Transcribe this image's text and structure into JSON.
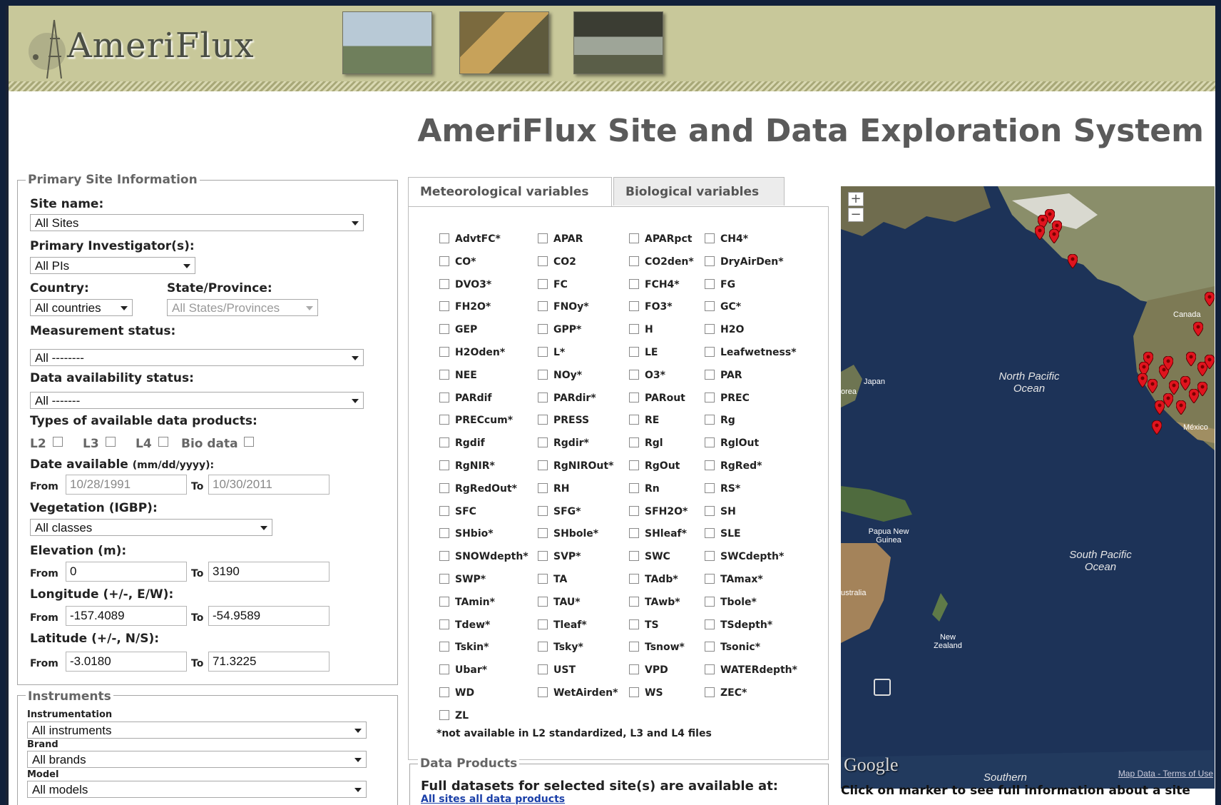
{
  "header": {
    "logo_text": "AmeriFlux",
    "page_title": "AmeriFlux Site and Data Exploration System"
  },
  "primary": {
    "legend": "Primary Site Information",
    "site_name_label": "Site name:",
    "site_name_value": "All Sites",
    "pi_label": "Primary Investigator(s):",
    "pi_value": "All PIs",
    "country_label": "Country:",
    "country_value": "All countries",
    "state_label": "State/Province:",
    "state_value": "All States/Provinces",
    "measurement_label": "Measurement status:",
    "measurement_value": "All --------",
    "availability_label": "Data availability status:",
    "availability_value": "All -------",
    "types_label": "Types of available data products:",
    "types": [
      "L2",
      "L3",
      "L4",
      "Bio data"
    ],
    "date_label": "Date available",
    "date_fmt": "(mm/dd/yyyy):",
    "from": "From",
    "to": "To",
    "date_from_placeholder": "10/28/1991",
    "date_to_placeholder": "10/30/2011",
    "veg_label": "Vegetation (IGBP):",
    "veg_value": "All classes",
    "elev_label": "Elevation (m):",
    "elev_from": "0",
    "elev_to": "3190",
    "lon_label": "Longitude (+/-, E/W):",
    "lon_from": "-157.4089",
    "lon_to": "-54.9589",
    "lat_label": "Latitude (+/-, N/S):",
    "lat_from": "-3.0180",
    "lat_to": "71.3225"
  },
  "instruments": {
    "legend": "Instruments",
    "instrumentation_label": "Instrumentation",
    "instrumentation_value": "All instruments",
    "brand_label": "Brand",
    "brand_value": "All brands",
    "model_label": "Model",
    "model_value": "All models"
  },
  "tabs": [
    "Meteorological variables",
    "Biological variables"
  ],
  "variables": [
    "AdvtFC*",
    "APAR",
    "APARpct",
    "CH4*",
    "CO*",
    "CO2",
    "CO2den*",
    "DryAirDen*",
    "DVO3*",
    "FC",
    "FCH4*",
    "FG",
    "FH2O*",
    "FNOy*",
    "FO3*",
    "GC*",
    "GEP",
    "GPP*",
    "H",
    "H2O",
    "H2Oden*",
    "L*",
    "LE",
    "Leafwetness*",
    "NEE",
    "NOy*",
    "O3*",
    "PAR",
    "PARdif",
    "PARdir*",
    "PARout",
    "PREC",
    "PRECcum*",
    "PRESS",
    "RE",
    "Rg",
    "Rgdif",
    "Rgdir*",
    "Rgl",
    "RglOut",
    "RgNIR*",
    "RgNIROut*",
    "RgOut",
    "RgRed*",
    "RgRedOut*",
    "RH",
    "Rn",
    "RS*",
    "SFC",
    "SFG*",
    "SFH2O*",
    "SH",
    "SHbio*",
    "SHbole*",
    "SHleaf*",
    "SLE",
    "SNOWdepth*",
    "SVP*",
    "SWC",
    "SWCdepth*",
    "SWP*",
    "TA",
    "TAdb*",
    "TAmax*",
    "TAmin*",
    "TAU*",
    "TAwb*",
    "Tbole*",
    "Tdew*",
    "Tleaf*",
    "TS",
    "TSdepth*",
    "Tskin*",
    "Tsky*",
    "Tsnow*",
    "Tsonic*",
    "Ubar*",
    "UST",
    "VPD",
    "WATERdepth*",
    "WD",
    "WetAirden*",
    "WS",
    "ZEC*",
    "ZL"
  ],
  "variables_note": "*not available in L2 standardized, L3 and L4 files",
  "data_products": {
    "legend": "Data Products",
    "heading": "Full datasets for selected site(s) are available at:",
    "link": "All sites all data products"
  },
  "map": {
    "labels": {
      "north_pacific": "North Pacific Ocean",
      "south_pacific": "South Pacific Ocean",
      "canada": "Canada",
      "mexico": "México",
      "japan": "Japan",
      "korea": "orea",
      "papua": "Papua New Guinea",
      "australia": "ustralia",
      "new_zealand": "New Zealand",
      "southern": "Southern",
      "google": "Google",
      "map_data": "Map Data",
      "sep": "-",
      "terms": "Terms of Use"
    },
    "zoom_in": "+",
    "zoom_out": "−",
    "footer": "Click on marker to see full information about a site"
  },
  "colors": {
    "banner": "#c8c89a",
    "ocean": "#1b2f52",
    "marker": "#e0141e",
    "link": "#1a3fa8"
  }
}
